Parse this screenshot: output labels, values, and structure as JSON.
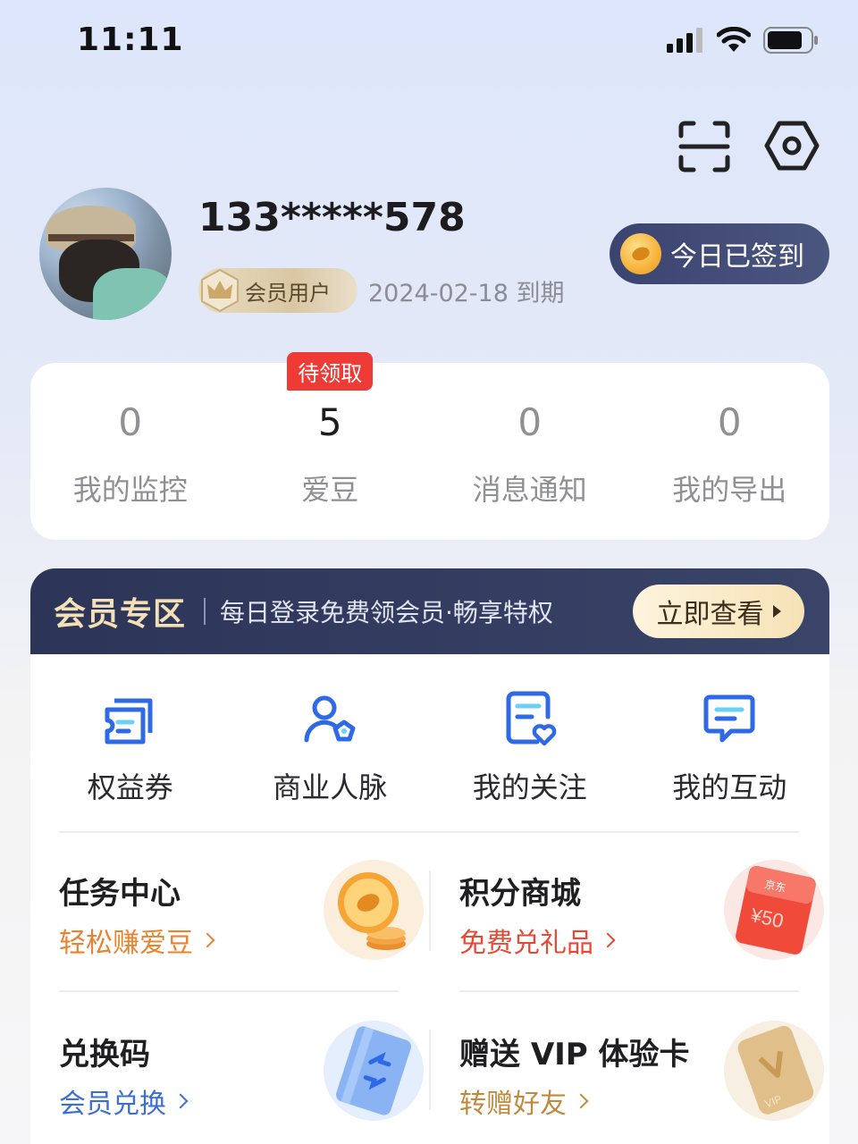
{
  "status_bar": {
    "time": "11:11"
  },
  "profile": {
    "phone": "133*****578",
    "member_badge": "会员用户",
    "expire_date": "2024-02-18",
    "expire_suffix": "到期",
    "signin_label": "今日已签到"
  },
  "stats": [
    {
      "value": "0",
      "label": "我的监控"
    },
    {
      "value": "5",
      "label": "爱豆",
      "tag": "待领取"
    },
    {
      "value": "0",
      "label": "消息通知"
    },
    {
      "value": "0",
      "label": "我的导出"
    }
  ],
  "member_zone": {
    "title": "会员专区",
    "desc": "每日登录免费领会员·畅享特权",
    "button": "立即查看"
  },
  "quick_actions": [
    {
      "label": "权益券",
      "icon": "coupon-icon"
    },
    {
      "label": "商业人脉",
      "icon": "contacts-icon"
    },
    {
      "label": "我的关注",
      "icon": "favorites-icon"
    },
    {
      "label": "我的互动",
      "icon": "message-icon"
    }
  ],
  "tasks": [
    {
      "title": "任务中心",
      "subtitle": "轻松赚爱豆",
      "color": "#e8832f",
      "art": "coin-stack-icon"
    },
    {
      "title": "积分商城",
      "subtitle": "免费兑礼品",
      "color": "#e64a35",
      "art": "gift-card-icon",
      "card_brand": "京东",
      "card_value": "¥50"
    },
    {
      "title": "兑换码",
      "subtitle": "会员兑换",
      "color": "#3b6fd6",
      "art": "redeem-card-icon"
    },
    {
      "title": "赠送 VIP 体验卡",
      "subtitle": "转赠好友",
      "color": "#c08a3e",
      "art": "vip-card-icon",
      "card_text": "VIP"
    }
  ],
  "colors": {
    "accent_blue": "#2f6ae6",
    "member_dark": "#2c3558",
    "badge_red": "#ef3b36"
  }
}
